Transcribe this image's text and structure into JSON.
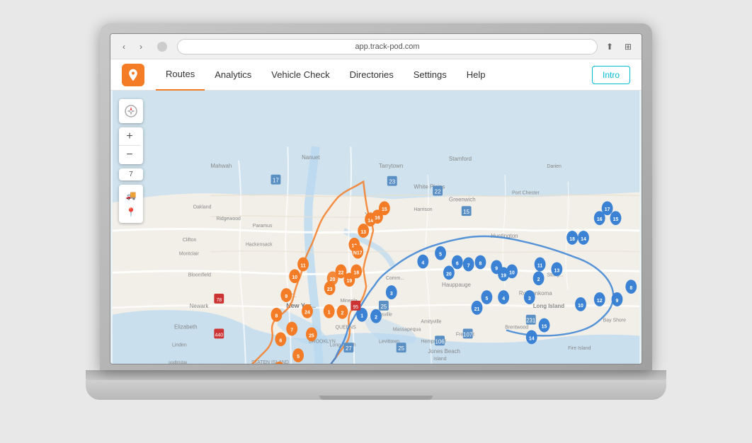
{
  "browser": {
    "url": "app.track-pod.com",
    "back_label": "‹",
    "forward_label": "›"
  },
  "navbar": {
    "logo_alt": "TrackPOD",
    "items": [
      {
        "id": "routes",
        "label": "Routes",
        "active": true
      },
      {
        "id": "analytics",
        "label": "Analytics",
        "active": false
      },
      {
        "id": "vehicle-check",
        "label": "Vehicle Check",
        "active": false
      },
      {
        "id": "directories",
        "label": "Directories",
        "active": false
      },
      {
        "id": "settings",
        "label": "Settings",
        "active": false
      },
      {
        "id": "help",
        "label": "Help",
        "active": false
      }
    ],
    "intro_button": "Intro"
  },
  "map": {
    "zoom_in": "+",
    "zoom_out": "−",
    "scale": "7"
  },
  "colors": {
    "orange": "#f47c26",
    "blue_route": "#3b82d4",
    "accent": "#00bcd4",
    "map_water": "#b8d8f0",
    "map_land": "#f2efe9",
    "map_roads": "#ffffff"
  }
}
